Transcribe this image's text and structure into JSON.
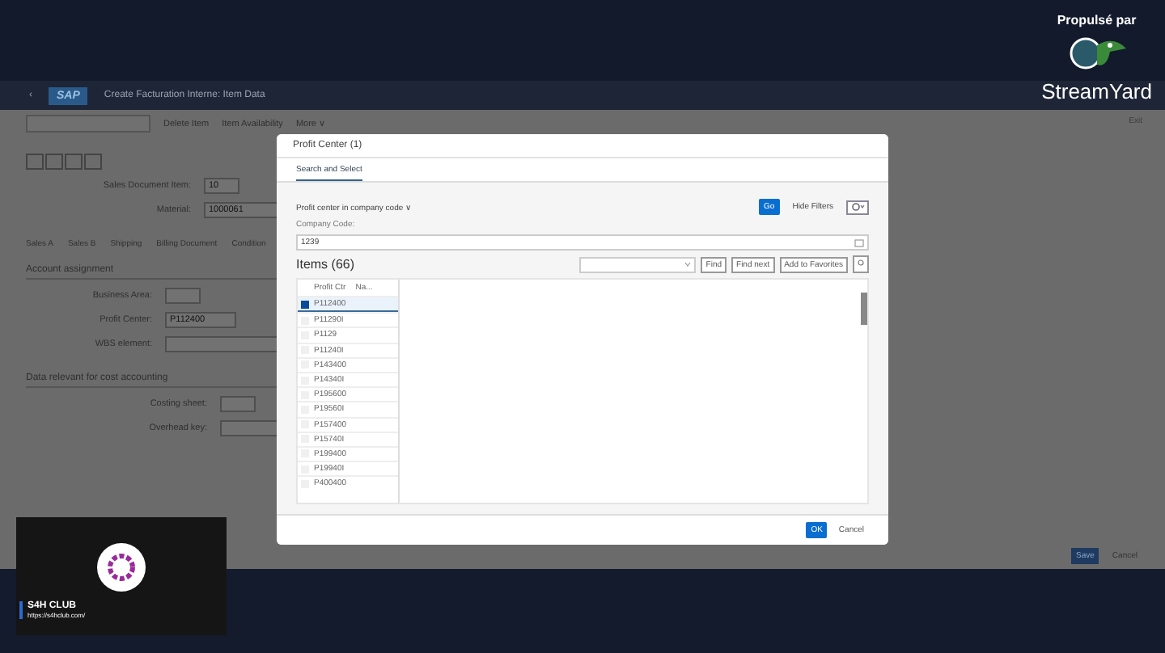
{
  "overlay": {
    "caption": "Propulsé par",
    "brand": "StreamYard"
  },
  "shell": {
    "back": "‹",
    "logo": "SAP",
    "title": "Create Facturation Interne: Item Data",
    "exit": "Exit"
  },
  "toolbar": {
    "actions": [
      "Delete Item",
      "Item Availability",
      "More ∨"
    ]
  },
  "header_fields": [
    {
      "label": "Sales Document Item:",
      "value": "10"
    },
    {
      "label": "Material:",
      "value": "1000061"
    }
  ],
  "tabs": [
    {
      "label": "Sales A",
      "selected": false
    },
    {
      "label": "Sales B",
      "selected": false
    },
    {
      "label": "Shipping",
      "selected": false
    },
    {
      "label": "Billing Document",
      "selected": false
    },
    {
      "label": "Condition",
      "selected": false
    }
  ],
  "sections": [
    {
      "title": "Account assignment",
      "fields": [
        {
          "label": "Business Area:"
        },
        {
          "label": "Profit Center:",
          "value": "P112400"
        },
        {
          "label": "WBS element:"
        }
      ]
    },
    {
      "title": "Data relevant for cost accounting",
      "fields": [
        {
          "label": "Costing sheet:"
        },
        {
          "label": "Overhead key:"
        }
      ]
    }
  ],
  "footer_buttons": [
    {
      "label": "Save",
      "kind": "primary"
    },
    {
      "label": "Cancel",
      "kind": "plain"
    }
  ],
  "dialog": {
    "title": "Profit Center (1)",
    "tabs": [
      {
        "label": "Search and Select",
        "selected": true
      }
    ],
    "variant": "Profit center in company code ∨",
    "go": "Go",
    "hide_filters": "Hide Filters",
    "filter": {
      "label": "Company Code:",
      "value": "1239"
    },
    "items_title": "Items (66)",
    "find_buttons": [
      "Find",
      "Find next",
      "Add to Favorites"
    ],
    "columns": [
      "Profit Ctr",
      "Na..."
    ],
    "rows": [
      {
        "id": "P112400",
        "selected": true
      },
      {
        "id": "P11290I",
        "selected": false
      },
      {
        "id": "P1129",
        "selected": false
      },
      {
        "id": "P11240I",
        "selected": false
      },
      {
        "id": "P143400",
        "selected": false
      },
      {
        "id": "P14340I",
        "selected": false
      },
      {
        "id": "P195600",
        "selected": false
      },
      {
        "id": "P19560I",
        "selected": false
      },
      {
        "id": "P157400",
        "selected": false
      },
      {
        "id": "P15740I",
        "selected": false
      },
      {
        "id": "P199400",
        "selected": false
      },
      {
        "id": "P19940I",
        "selected": false
      },
      {
        "id": "P400400",
        "selected": false
      }
    ],
    "buttons": [
      {
        "label": "OK",
        "kind": "primary"
      },
      {
        "label": "Cancel",
        "kind": "plain"
      }
    ]
  },
  "presenter": {
    "name": "S4H CLUB",
    "url": "https://s4hclub.com/"
  }
}
